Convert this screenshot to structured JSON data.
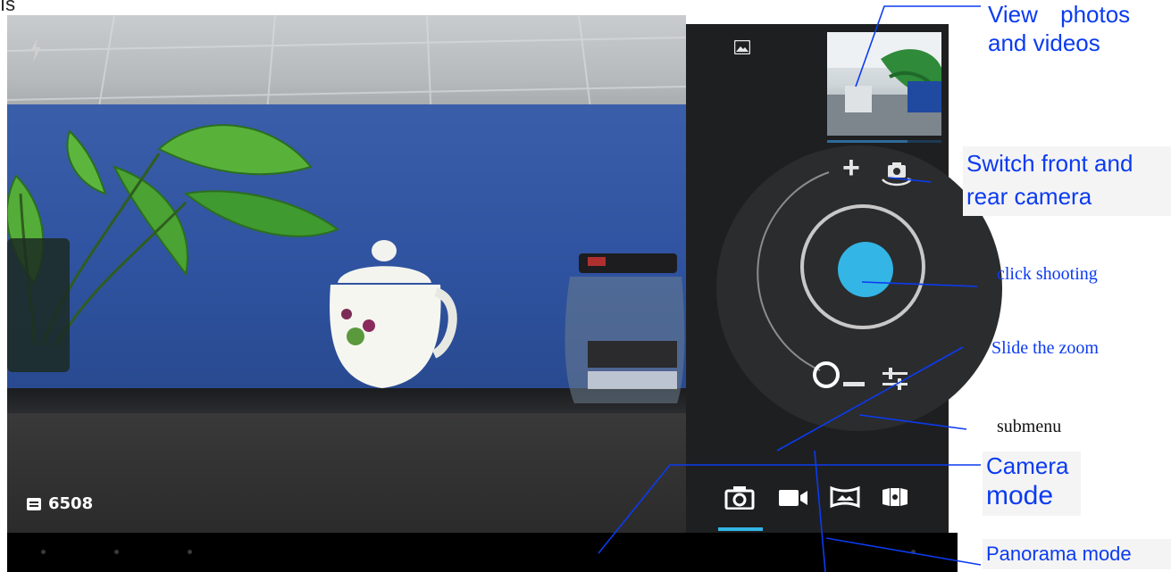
{
  "preview": {
    "storage_count": "6508",
    "flash_icon": "flash-auto-icon",
    "storage_icon": "storage-card-icon"
  },
  "panel": {
    "gallery_icon": "gallery-icon",
    "zoom_plus_label": "+",
    "thumbnail_progress": 0.7,
    "accent_color": "#33b5e5",
    "modes": [
      {
        "name": "Camera",
        "icon": "camera-icon",
        "selected": true
      },
      {
        "name": "Video",
        "icon": "video-camera-icon",
        "selected": false
      },
      {
        "name": "Panorama",
        "icon": "panorama-icon",
        "selected": false
      },
      {
        "name": "Photo sphere",
        "icon": "photo-sphere-icon",
        "selected": false
      }
    ]
  },
  "annotations": {
    "view_photos_line1": "View photos",
    "view_photos_line2": "and videos",
    "switch_camera_line1": "Switch front and",
    "switch_camera_line2": "rear camera",
    "click_shooting": "click shooting",
    "slide_zoom": "Slide the zoom",
    "submenu": "submenu",
    "camera_mode_line1": "Camera",
    "camera_mode_line2": "mode",
    "panorama_mode": "Panorama mode",
    "annotation_color": "#0b3bf0"
  }
}
